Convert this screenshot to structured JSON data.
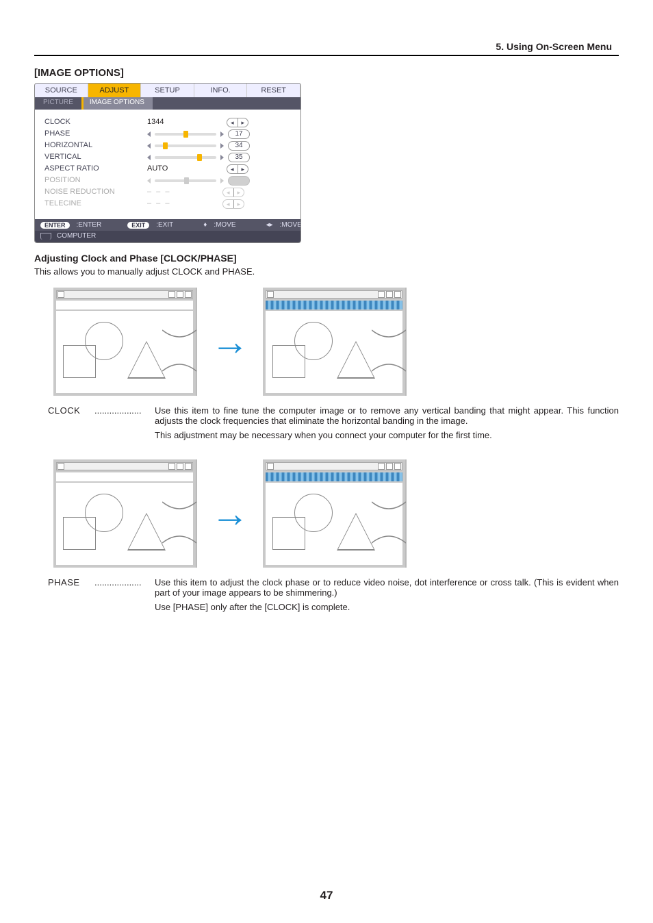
{
  "header": {
    "chapter": "5. Using On-Screen Menu"
  },
  "section": {
    "title": "[IMAGE OPTIONS]"
  },
  "osd": {
    "tabs": [
      "SOURCE",
      "ADJUST",
      "SETUP",
      "INFO.",
      "RESET"
    ],
    "subtabs": [
      "PICTURE",
      "IMAGE OPTIONS"
    ],
    "items": {
      "clock": {
        "label": "CLOCK",
        "value": "1344"
      },
      "phase": {
        "label": "PHASE",
        "value": "17"
      },
      "horiz": {
        "label": "HORIZONTAL",
        "value": "34"
      },
      "vert": {
        "label": "VERTICAL",
        "value": "35"
      },
      "aspect": {
        "label": "ASPECT RATIO",
        "value": "AUTO"
      },
      "position": {
        "label": "POSITION"
      },
      "nr": {
        "label": "NOISE REDUCTION",
        "value": "– – –"
      },
      "telecine": {
        "label": "TELECINE",
        "value": "– – –"
      }
    },
    "footer": {
      "enter": "ENTER",
      "enter_label": ":ENTER",
      "exit": "EXIT",
      "exit_label": ":EXIT",
      "move1": ":MOVE",
      "move2": ":MOVE",
      "source": "COMPUTER"
    }
  },
  "sub": {
    "heading": "Adjusting Clock and Phase [CLOCK/PHASE]",
    "intro": "This allows you to manually adjust CLOCK and PHASE."
  },
  "defs": {
    "clock": {
      "term": "CLOCK",
      "dots": "...................",
      "p1": "Use this item to fine tune the computer image or to remove any vertical banding that might appear. This function adjusts the clock frequencies that eliminate the horizontal banding in the image.",
      "p2": "This adjustment may be necessary when you connect your computer for the first time."
    },
    "phase": {
      "term": "PHASE",
      "dots": "...................",
      "p1": "Use this item to adjust the clock phase or to reduce video noise, dot interference or cross talk. (This is evident when part of your image appears to be shimmering.)",
      "p2": "Use [PHASE] only after the [CLOCK] is complete."
    }
  },
  "page_number": "47"
}
